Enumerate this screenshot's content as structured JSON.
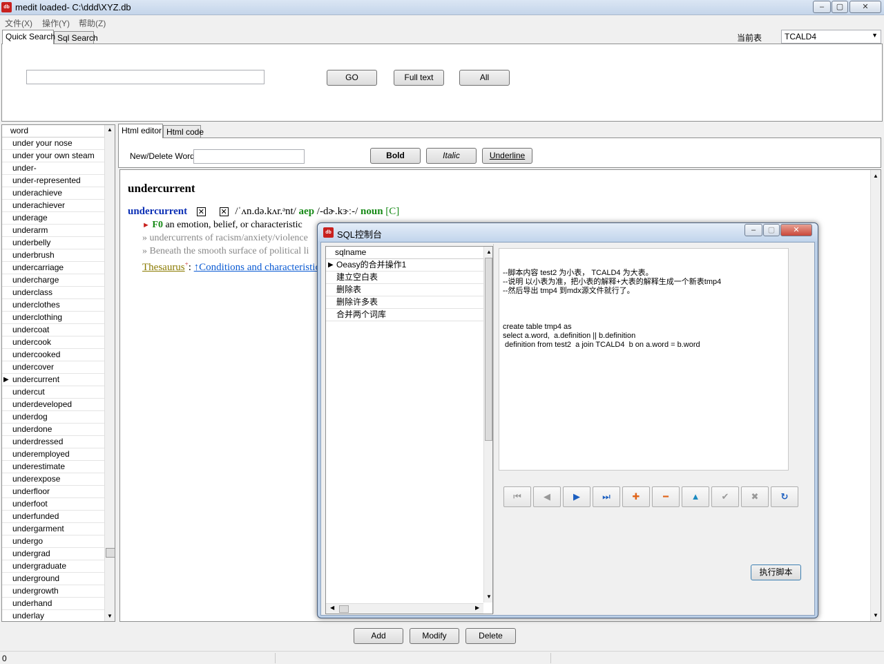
{
  "window": {
    "title": "medit loaded- C:\\ddd\\XYZ.db"
  },
  "menu": [
    "文件(X)",
    "操作(Y)",
    "帮助(Z)"
  ],
  "top_tabs": [
    "Quick Search",
    "Sql Search"
  ],
  "table_selector": {
    "label": "当前表",
    "value": "TCALD4"
  },
  "search": {
    "value": "",
    "go_label": "GO",
    "fulltext_label": "Full text",
    "all_label": "All"
  },
  "word_list": {
    "header": "word",
    "selected": "undercurrent",
    "items": [
      "under your nose",
      "under your own steam",
      "under-",
      "under-represented",
      "underachieve",
      "underachiever",
      "underage",
      "underarm",
      "underbelly",
      "underbrush",
      "undercarriage",
      "undercharge",
      "underclass",
      "underclothes",
      "underclothing",
      "undercoat",
      "undercook",
      "undercooked",
      "undercover",
      "undercurrent",
      "undercut",
      "underdeveloped",
      "underdog",
      "underdone",
      "underdressed",
      "underemployed",
      "underestimate",
      "underexpose",
      "underfloor",
      "underfoot",
      "underfunded",
      "undergarment",
      "undergo",
      "undergrad",
      "undergraduate",
      "underground",
      "undergrowth",
      "underhand",
      "underlay"
    ]
  },
  "editor_tabs": [
    "Html editor",
    "Html code"
  ],
  "editor_toolbar": {
    "new_delete_label": "New/Delete Word",
    "word_value": "",
    "bold": "Bold",
    "italic": "Italic",
    "underline": "Underline"
  },
  "entry": {
    "headword": "undercurrent",
    "head2": "undercurrent",
    "pron_uk": "/ˈʌn.də.kʌr.ᵊnt/",
    "aep": "aep",
    "pron_us": "/-dɚ.kɝː-/",
    "pos": "noun",
    "gram": "[C]",
    "sense_marker": "►",
    "sense_code": "F0",
    "definition": "an emotion, belief, or characteristic",
    "example1": "» undercurrents of racism/anxiety/violence",
    "example2": "» Beneath the smooth surface of political li",
    "thesaurus_label": "Thesaurus",
    "thesaurus_sup": "+",
    "thesaurus_colon": ":",
    "thesaurus_link": "↑Conditions and characteristic"
  },
  "bottom_buttons": {
    "add": "Add",
    "modify": "Modify",
    "delete": "Delete"
  },
  "status": {
    "text": "0"
  },
  "dialog": {
    "title": "SQL控制台",
    "grid_header": "sqlname",
    "rows": [
      "Oeasy的合并操作1",
      "建立空白表",
      "删除表",
      "删除许多表",
      "合并两个词库"
    ],
    "script_lines": [
      "--脚本内容 test2 为小表， TCALD4 为大表。",
      "--说明 以小表为准，把小表的解释+大表的解释生成一个新表tmp4",
      "--然后导出 tmp4 到mdx源文件就行了。",
      "",
      "",
      "",
      "create table tmp4 as",
      "select a.word,  a.definition || b.definition",
      " definition from test2  a join TCALD4  b on a.word = b.word"
    ],
    "execute_label": "执行脚本"
  }
}
